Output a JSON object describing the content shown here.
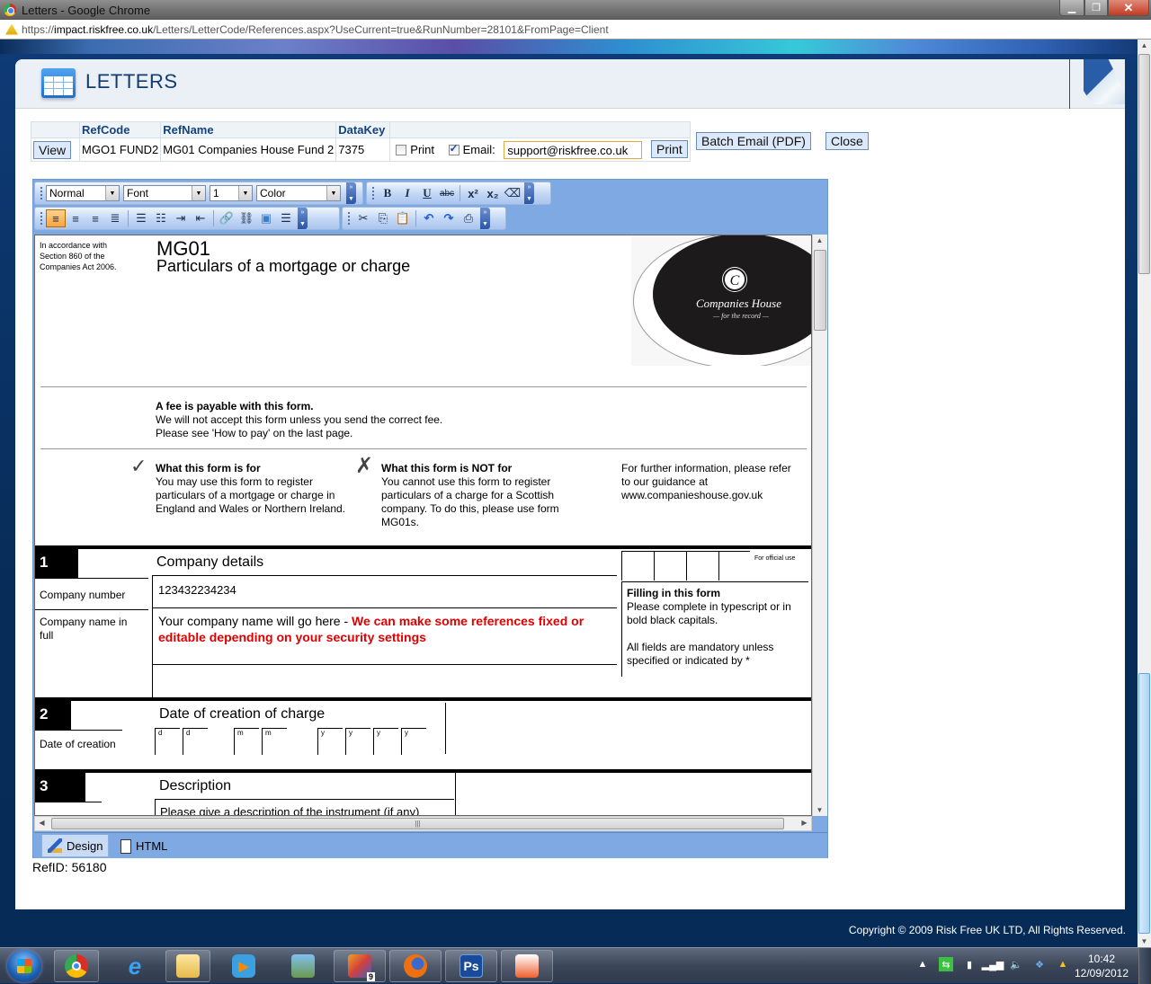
{
  "window": {
    "title": "Letters - Google Chrome",
    "url_prefix": "https://",
    "url_domain": "impact.riskfree.co.uk",
    "url_path": "/Letters/LetterCode/References.aspx?UseCurrent=true&RunNumber=28101&FromPage=Client",
    "min_icon": "minimize-icon",
    "max_icon": "restore-icon",
    "close_icon": "close-icon"
  },
  "header": {
    "title": "LETTERS",
    "icon": "table-grid-icon"
  },
  "reftable": {
    "columns": [
      "",
      "RefCode",
      "RefName",
      "DataKey",
      ""
    ],
    "row": {
      "view_label": "View",
      "refcode": "MGO1 FUND2",
      "refname": "MG01 Companies House Fund 2",
      "datakey": "7375",
      "print_checkbox_label": "Print",
      "print_checked": false,
      "email_checkbox_label": "Email:",
      "email_checked": true,
      "email_value": "support@riskfree.co.uk",
      "print_button": "Print"
    }
  },
  "actions": {
    "batch_email": "Batch Email (PDF)",
    "close": "Close"
  },
  "editor": {
    "format_select": "Normal",
    "font_select": "Font",
    "size_select": "1",
    "color_select": "Color",
    "buttons_row1": [
      {
        "name": "bold-icon",
        "glyph": "B"
      },
      {
        "name": "italic-icon",
        "glyph": "I"
      },
      {
        "name": "underline-icon",
        "glyph": "U"
      },
      {
        "name": "strikethrough-icon",
        "glyph": "abc"
      },
      {
        "name": "superscript-icon",
        "glyph": "x²"
      },
      {
        "name": "subscript-icon",
        "glyph": "x₂"
      },
      {
        "name": "eraser-icon",
        "glyph": "⌫"
      }
    ],
    "buttons_row2a": [
      {
        "name": "align-left-icon",
        "glyph": "≡"
      },
      {
        "name": "align-right-icon",
        "glyph": "≡"
      },
      {
        "name": "align-center-icon",
        "glyph": "≡"
      },
      {
        "name": "justify-icon",
        "glyph": "≣"
      },
      {
        "name": "bullet-list-icon",
        "glyph": "☰"
      },
      {
        "name": "numbered-list-icon",
        "glyph": "☷"
      },
      {
        "name": "indent-icon",
        "glyph": "⇥"
      },
      {
        "name": "outdent-icon",
        "glyph": "⇤"
      },
      {
        "name": "insert-link-icon",
        "glyph": "🔗"
      },
      {
        "name": "unlink-icon",
        "glyph": "⛓"
      },
      {
        "name": "insert-image-icon",
        "glyph": "▣"
      },
      {
        "name": "horizontal-rule-icon",
        "glyph": "☰"
      }
    ],
    "buttons_row2b": [
      {
        "name": "cut-icon",
        "glyph": "✂"
      },
      {
        "name": "copy-icon",
        "glyph": "⎘"
      },
      {
        "name": "paste-icon",
        "glyph": "📋"
      },
      {
        "name": "undo-icon",
        "glyph": "↶"
      },
      {
        "name": "redo-icon",
        "glyph": "↷"
      },
      {
        "name": "print-icon",
        "glyph": "⎙"
      }
    ],
    "modes": {
      "design": "Design",
      "html": "HTML"
    }
  },
  "document": {
    "legal_note": [
      "In accordance with",
      "Section 860 of the",
      "Companies Act 2006."
    ],
    "form_code": "MG01",
    "form_title": "Particulars of a mortgage or charge",
    "logo": {
      "monogram": "C",
      "name": "Companies House",
      "tagline": "for the record"
    },
    "fee": {
      "heading": "A fee is payable with this form.",
      "line1": "We will not accept this form unless you send the correct fee.",
      "line2": "Please see 'How to pay' on the last page."
    },
    "is_for": {
      "heading": "What this form is for",
      "lines": [
        "You may use this form to register",
        "particulars of a mortgage or charge in",
        "England and Wales or Northern Ireland."
      ]
    },
    "not_for": {
      "heading": "What this form is NOT for",
      "lines": [
        "You cannot use this form to register",
        "particulars of a charge for a Scottish",
        "company. To do this, please use form",
        "MG01s."
      ]
    },
    "further": {
      "lines": [
        "For further information, please refer",
        "to our guidance at",
        "www.companieshouse.gov.uk"
      ]
    },
    "section1": {
      "number": "1",
      "title": "Company details",
      "official_use": "For official use",
      "company_number_label": "Company number",
      "company_number_value": "123432234234",
      "company_name_label": [
        "Company name in",
        "full"
      ],
      "company_name_value": "Your company name will go here - ",
      "company_name_note": "We can make some references fixed or editable depending on your security settings",
      "filling_heading": "Filling in this form",
      "filling_lines": [
        "Please complete in typescript or in",
        "bold black capitals."
      ],
      "mandatory_lines": [
        "All fields are mandatory unless",
        "specified or indicated by *"
      ]
    },
    "section2": {
      "number": "2",
      "title": "Date of creation of charge",
      "date_label": "Date of creation",
      "date_placeholders": [
        "d",
        "d",
        "m",
        "m",
        "y",
        "y",
        "y",
        "y"
      ]
    },
    "section3": {
      "number": "3",
      "title": "Description",
      "hint": "Please give a description of the instrument (if any)"
    }
  },
  "footer": {
    "refid": "RefID: 56180",
    "copyright": "Copyright © 2009 Risk Free UK LTD, All Rights Reserved."
  },
  "taskbar": {
    "apps": [
      {
        "name": "chrome-icon",
        "active": true
      },
      {
        "name": "internet-explorer-icon",
        "active": false
      },
      {
        "name": "file-explorer-icon",
        "active": true
      },
      {
        "name": "media-player-icon",
        "active": false
      },
      {
        "name": "photo-gallery-icon",
        "active": false
      },
      {
        "name": "visual-studio-icon",
        "active": true,
        "badge": "9"
      },
      {
        "name": "firefox-icon",
        "active": true
      },
      {
        "name": "photoshop-icon",
        "active": true,
        "glyph": "Ps"
      },
      {
        "name": "picture-manager-icon",
        "active": true
      }
    ],
    "tray": [
      "show-hidden-icons-icon",
      "sync-icon",
      "power-icon",
      "network-signal-icon",
      "volume-icon",
      "dropbox-icon",
      "google-drive-icon"
    ],
    "time": "10:42",
    "date": "12/09/2012"
  },
  "colors": {
    "accent_blue": "#123b72",
    "header_text": "#13437c",
    "warning_red": "#e00000",
    "editor_blue": "#7fa9e2"
  }
}
